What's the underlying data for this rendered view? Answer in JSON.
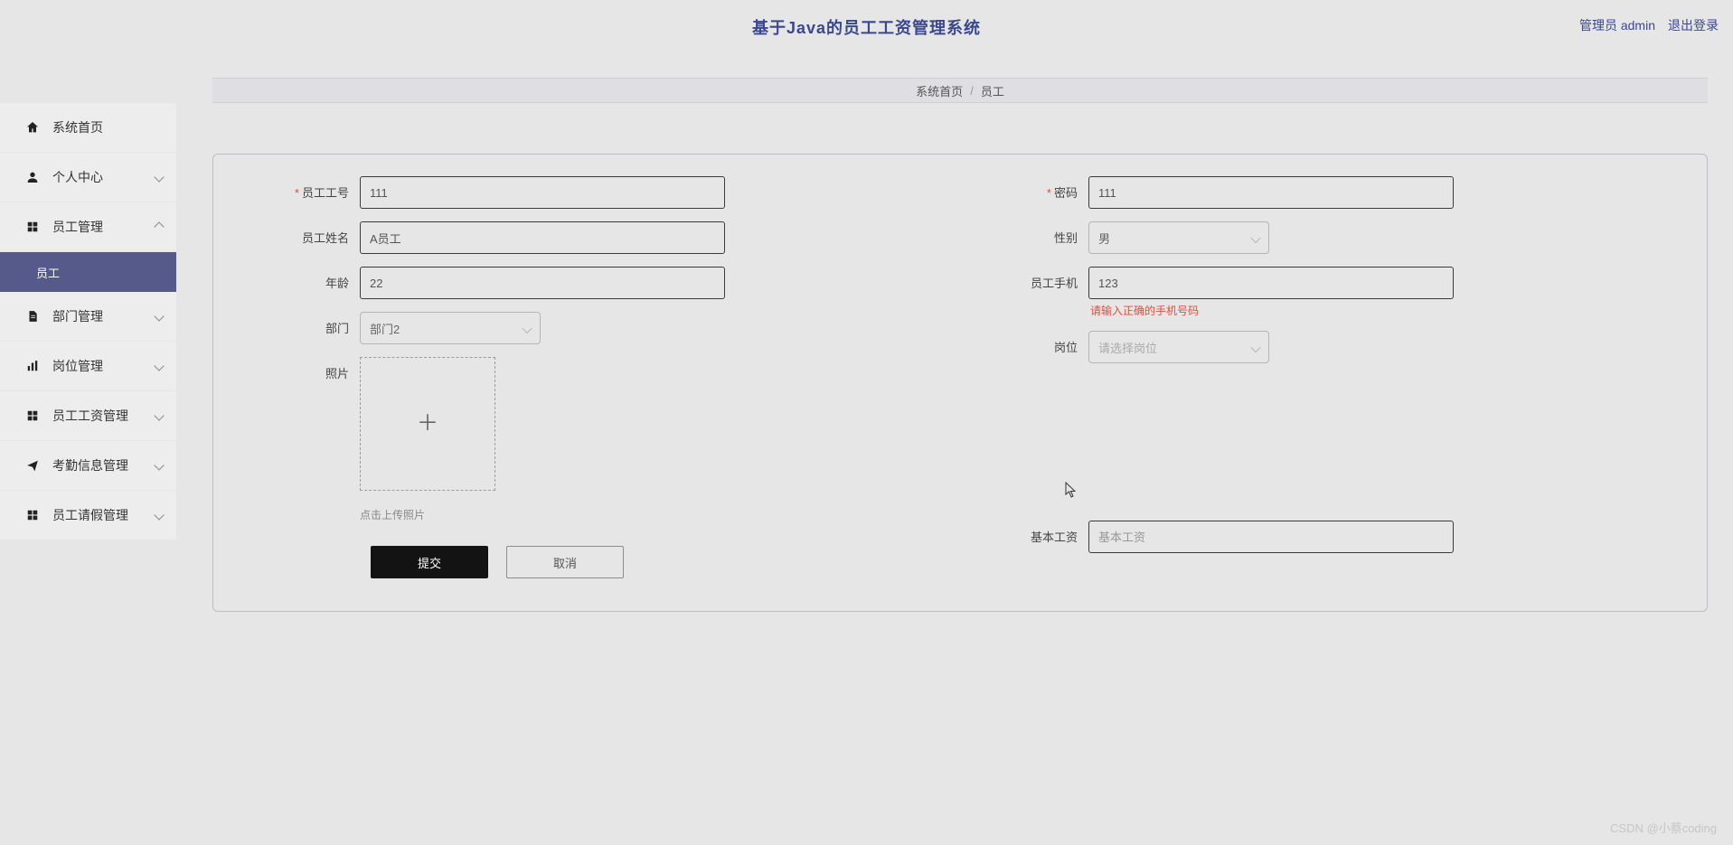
{
  "header": {
    "title": "基于Java的员工工资管理系统",
    "admin_label": "管理员 admin",
    "logout_label": "退出登录"
  },
  "sidebar": {
    "items": [
      {
        "icon": "home",
        "label": "系统首页",
        "chev": null
      },
      {
        "icon": "person",
        "label": "个人中心",
        "chev": "down"
      },
      {
        "icon": "grid",
        "label": "员工管理",
        "chev": "up",
        "sub": [
          {
            "label": "员工"
          }
        ]
      },
      {
        "icon": "file",
        "label": "部门管理",
        "chev": "down"
      },
      {
        "icon": "bars",
        "label": "岗位管理",
        "chev": "down"
      },
      {
        "icon": "grid",
        "label": "员工工资管理",
        "chev": "down"
      },
      {
        "icon": "send",
        "label": "考勤信息管理",
        "chev": "down"
      },
      {
        "icon": "grid",
        "label": "员工请假管理",
        "chev": "down"
      }
    ]
  },
  "breadcrumb": {
    "home": "系统首页",
    "current": "员工"
  },
  "form": {
    "left": {
      "emp_id": {
        "label": "员工工号",
        "value": "111",
        "required": true
      },
      "emp_name": {
        "label": "员工姓名",
        "value": "A员工",
        "required": false
      },
      "age": {
        "label": "年龄",
        "value": "22",
        "required": false
      },
      "dept": {
        "label": "部门",
        "value": "部门2",
        "required": false
      },
      "photo": {
        "label": "照片",
        "hint": "点击上传照片"
      }
    },
    "right": {
      "password": {
        "label": "密码",
        "value": "111",
        "required": true
      },
      "gender": {
        "label": "性别",
        "value": "男",
        "required": false
      },
      "phone": {
        "label": "员工手机",
        "value": "123",
        "error": "请输入正确的手机号码",
        "required": false
      },
      "position": {
        "label": "岗位",
        "placeholder": "请选择岗位",
        "required": false
      },
      "base_salary": {
        "label": "基本工资",
        "placeholder": "基本工资",
        "required": false
      }
    },
    "buttons": {
      "submit": "提交",
      "cancel": "取消"
    }
  },
  "watermark": "CSDN @小蔡coding"
}
